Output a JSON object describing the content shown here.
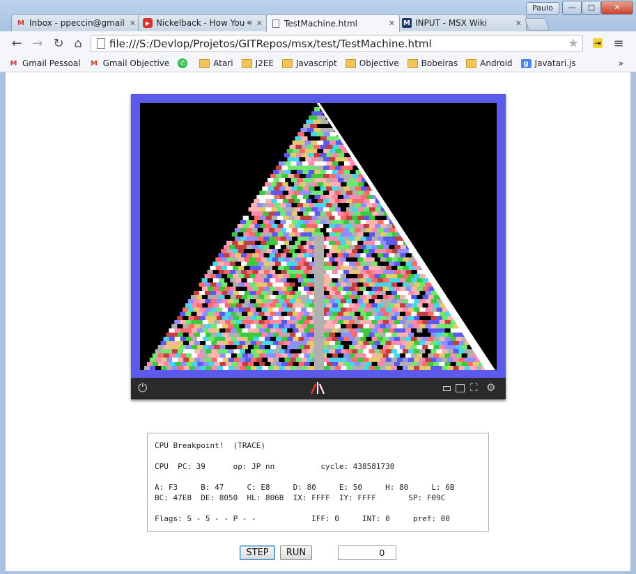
{
  "window": {
    "user": "Paulo",
    "minimize": "—",
    "maximize": "□",
    "close": "✕"
  },
  "tabs": [
    {
      "label": "Inbox - ppeccin@gmail.c",
      "icon": "gmail-icon",
      "active": false
    },
    {
      "label": "Nickelback - How You",
      "icon": "youtube-icon",
      "active": false
    },
    {
      "label": "TestMachine.html",
      "icon": "page-icon",
      "active": true
    },
    {
      "label": "INPUT - MSX Wiki",
      "icon": "msx-icon",
      "active": false
    }
  ],
  "address": {
    "url": "file:///S:/Devlop/Projetos/GITRepos/msx/test/TestMachine.html"
  },
  "bookmarks": [
    {
      "label": "Gmail Pessoal",
      "icon": "gmail-icon"
    },
    {
      "label": "Gmail Objective",
      "icon": "gmail-icon"
    },
    {
      "label": "",
      "icon": "whatsapp-icon"
    },
    {
      "label": "Atari",
      "icon": "folder-icon"
    },
    {
      "label": "J2EE",
      "icon": "folder-icon"
    },
    {
      "label": "Javascript",
      "icon": "folder-icon"
    },
    {
      "label": "Objective",
      "icon": "folder-icon"
    },
    {
      "label": "Bobeiras",
      "icon": "folder-icon"
    },
    {
      "label": "Android",
      "icon": "folder-icon"
    },
    {
      "label": "Javatari.js",
      "icon": "google-icon"
    }
  ],
  "bookmarks_overflow": "»",
  "colors": {
    "screen_border": "#5b5aec",
    "pyramid_palette": [
      "#ff6b6b",
      "#ffffff",
      "#3ec83e",
      "#5b5aec",
      "#e6c96b",
      "#ff8ab0",
      "#47d7ea",
      "#c24040",
      "#000000",
      "#b0b0b0",
      "#8f8fff",
      "#6fe86f",
      "#ffb3b3"
    ]
  },
  "debug": {
    "line1": "CPU Breakpoint!  (TRACE)",
    "line2": "CPU  PC: 39      op: JP nn          cycle: 438581730",
    "line3": "A: F3     B: 47     C: E8     D: 80     E: 50     H: 80     L: 6B",
    "line4": "BC: 47E8  DE: 8050  HL: 806B  IX: FFFF  IY: FFFF       SP: F09C",
    "line5": "Flags: S - 5 - - P - -            IFF: 0     INT: 0     pref: 00"
  },
  "controls": {
    "step_label": "STEP",
    "run_label": "RUN",
    "step_count": "0"
  }
}
